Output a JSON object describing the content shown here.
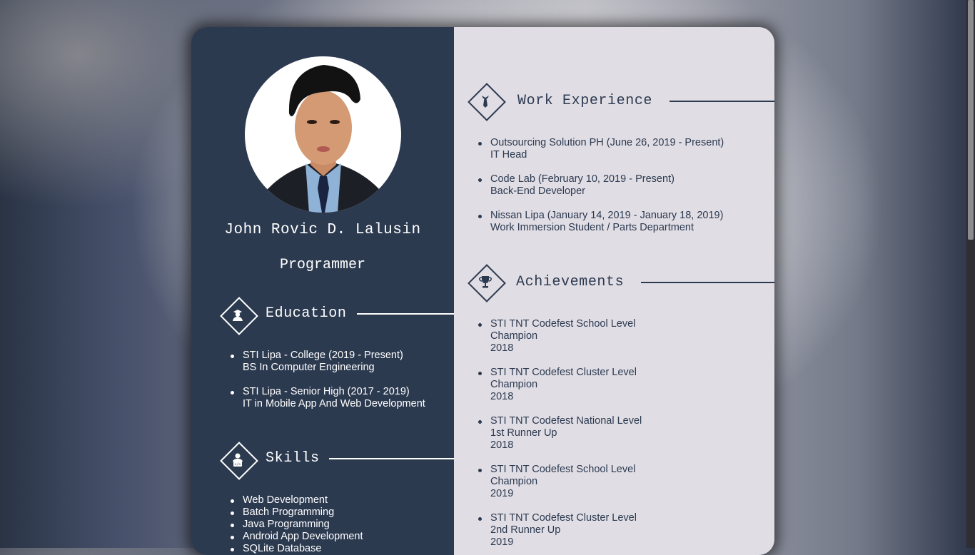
{
  "profile": {
    "name": "John Rovic D. Lalusin",
    "role": "Programmer"
  },
  "education": {
    "title": "Education",
    "items": [
      {
        "line1": "STI Lipa - College (2019 - Present)",
        "line2": "BS In Computer Engineering"
      },
      {
        "line1": "STI Lipa - Senior High (2017 - 2019)",
        "line2": "IT in Mobile App And Web Development"
      }
    ]
  },
  "skills": {
    "title": "Skills",
    "items": [
      "Web Development",
      "Batch Programming",
      "Java Programming",
      "Android App Development",
      "SQLite Database"
    ]
  },
  "work": {
    "title": "Work Experience",
    "items": [
      {
        "line1": "Outsourcing Solution PH (June 26, 2019 - Present)",
        "line2": "IT Head"
      },
      {
        "line1": "Code Lab (February 10, 2019 - Present)",
        "line2": "Back-End Developer"
      },
      {
        "line1": "Nissan Lipa (January 14, 2019 - January 18, 2019)",
        "line2": "Work Immersion Student / Parts Department"
      }
    ]
  },
  "achievements": {
    "title": "Achievements",
    "items": [
      {
        "line1": "STI TNT Codefest School Level",
        "line2": "Champion",
        "line3": "2018"
      },
      {
        "line1": "STI TNT Codefest Cluster Level",
        "line2": "Champion",
        "line3": "2018"
      },
      {
        "line1": "STI TNT Codefest National Level",
        "line2": "1st Runner Up",
        "line3": "2018"
      },
      {
        "line1": "STI TNT Codefest School Level",
        "line2": "Champion",
        "line3": "2019"
      },
      {
        "line1": "STI TNT Codefest Cluster Level",
        "line2": "2nd Runner Up",
        "line3": "2019"
      }
    ]
  },
  "icons": {
    "education": "graduate-icon",
    "skills": "coder-icon",
    "work": "necktie-icon",
    "achievements": "trophy-icon"
  },
  "colors": {
    "left_panel": "#2c3a50",
    "right_panel": "#e0dde4",
    "accent_light": "#ffffff"
  }
}
